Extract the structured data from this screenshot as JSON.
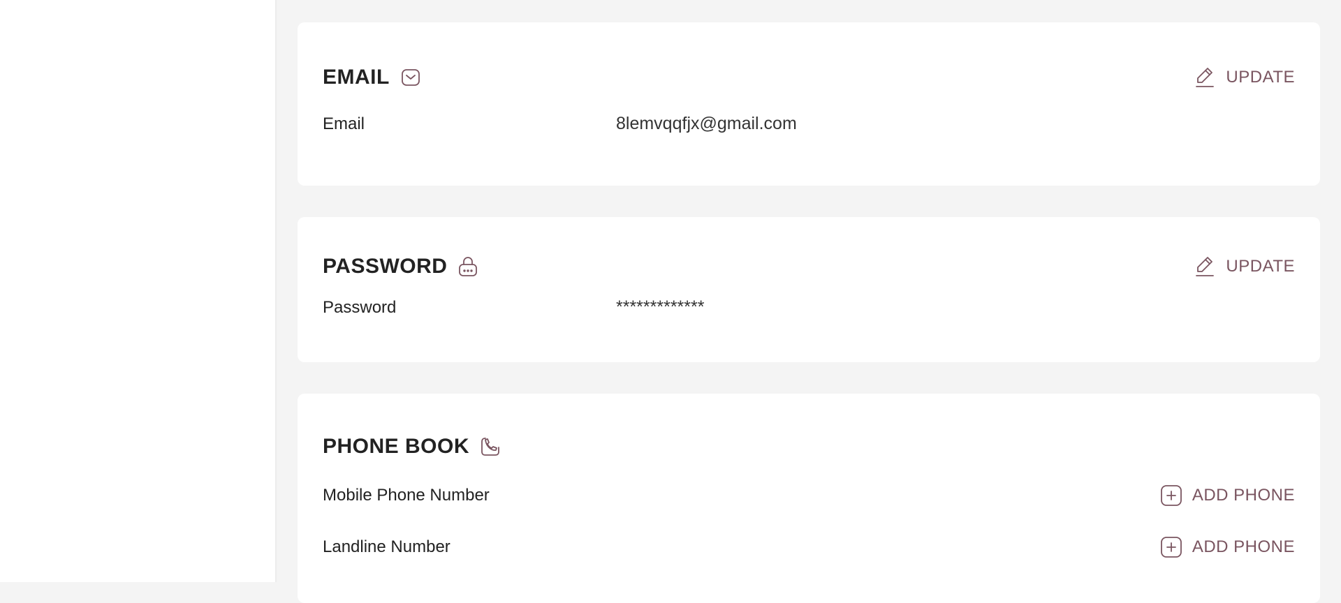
{
  "email_section": {
    "title": "EMAIL",
    "update_label": "UPDATE",
    "field_label": "Email",
    "field_value": "8lemvqqfjx@gmail.com"
  },
  "password_section": {
    "title": "PASSWORD",
    "update_label": "UPDATE",
    "field_label": "Password",
    "field_value": "*************"
  },
  "phone_section": {
    "title": "PHONE BOOK",
    "rows": [
      {
        "label": "Mobile Phone Number",
        "action_label": "ADD PHONE"
      },
      {
        "label": "Landline Number",
        "action_label": "ADD PHONE"
      }
    ]
  },
  "colors": {
    "accent": "#7a5560",
    "background": "#f4f4f4",
    "card": "#ffffff",
    "text": "#222222"
  },
  "icons": {
    "email": "envelope-icon",
    "password": "lock-icon",
    "phone": "phone-icon",
    "update": "pencil-icon",
    "add": "plus-square-icon"
  }
}
